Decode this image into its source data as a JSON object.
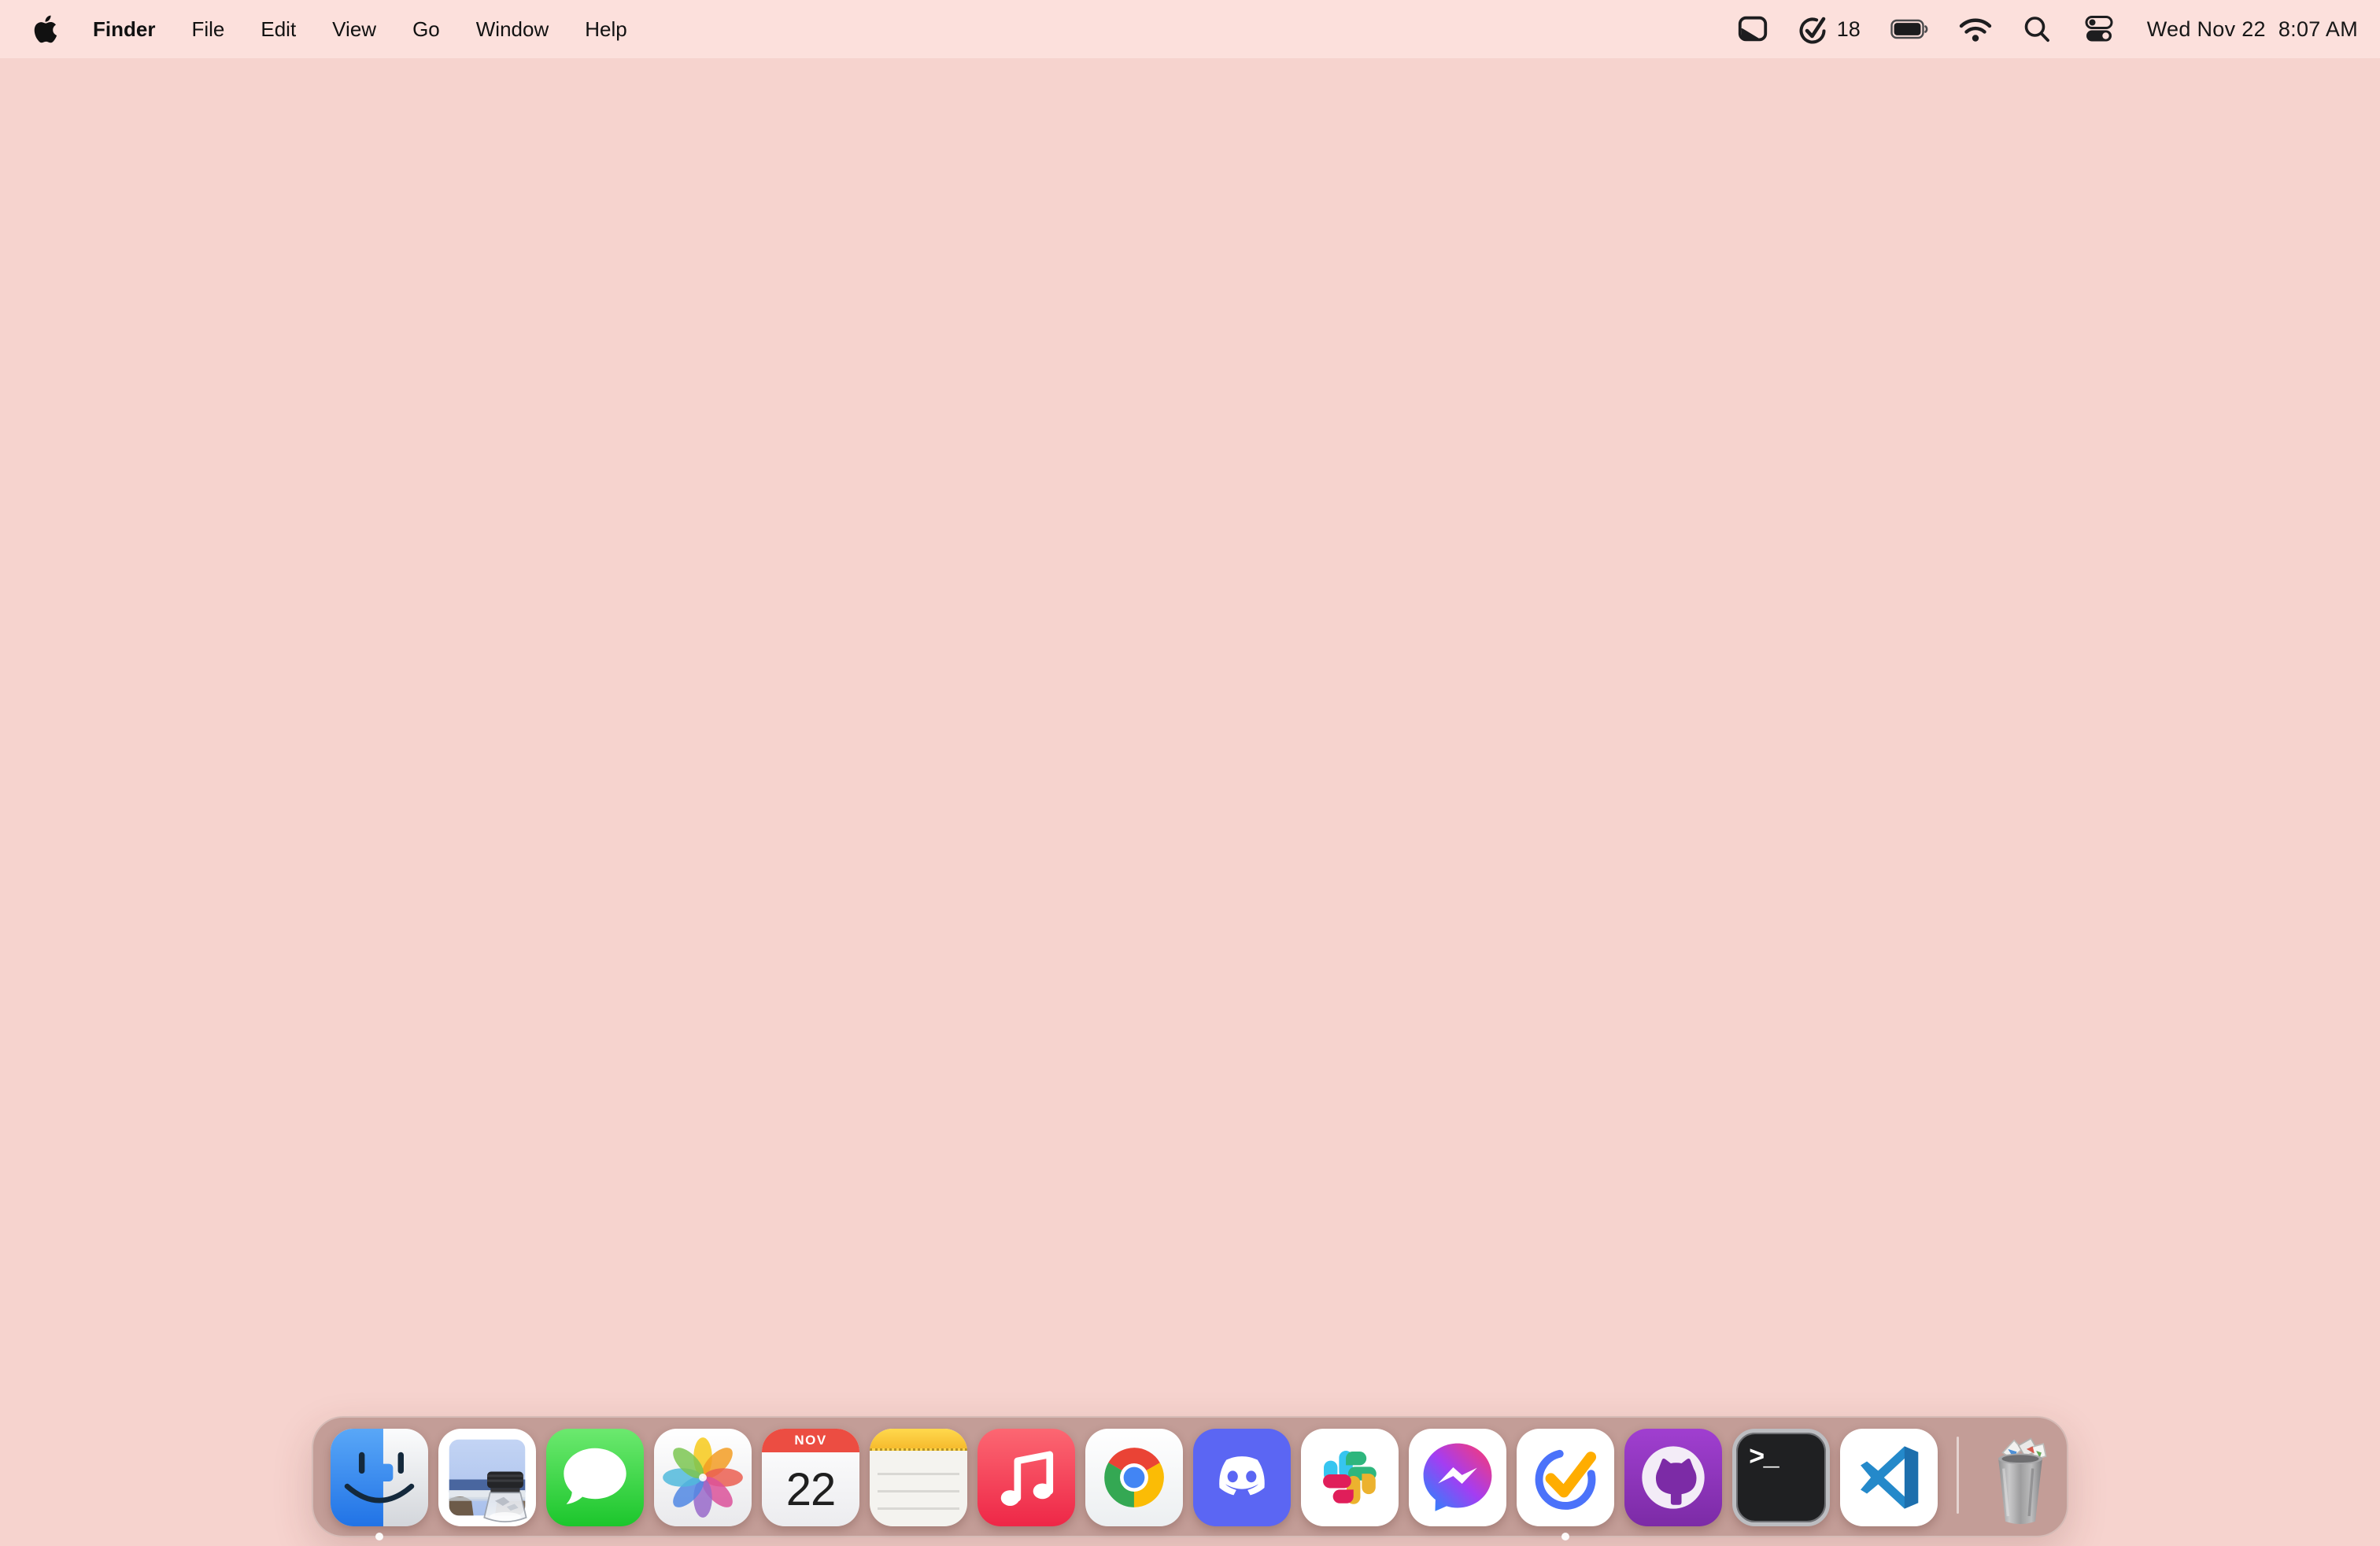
{
  "menu_bar": {
    "active_app_menus": [
      {
        "label": "Finder",
        "bold": true
      },
      {
        "label": "File"
      },
      {
        "label": "Edit"
      },
      {
        "label": "View"
      },
      {
        "label": "Go"
      },
      {
        "label": "Window"
      },
      {
        "label": "Help"
      }
    ],
    "status": {
      "screen_mirroring_icon": "screen-mirroring-icon",
      "task_badge": {
        "icon": "check-circle-icon",
        "count": "18"
      },
      "battery_icon": "battery-full-icon",
      "wifi_icon": "wifi-icon",
      "spotlight_icon": "search-icon",
      "control_center_icon": "control-center-icon",
      "date": "Wed Nov 22",
      "time": "8:07 AM"
    }
  },
  "desktop": {
    "wallpaper_color": "#f6d3ce",
    "menubar_color": "#fce0dc"
  },
  "dock": {
    "background_color": "rgba(143,103,96,0.50)",
    "apps": [
      {
        "name": "finder",
        "running": true
      },
      {
        "name": "preview",
        "running": false
      },
      {
        "name": "messages",
        "running": false
      },
      {
        "name": "photos",
        "running": false
      },
      {
        "name": "calendar",
        "running": false
      },
      {
        "name": "notes",
        "running": false
      },
      {
        "name": "music",
        "running": false
      },
      {
        "name": "chrome",
        "running": false
      },
      {
        "name": "discord",
        "running": false
      },
      {
        "name": "slack",
        "running": false
      },
      {
        "name": "messenger",
        "running": false
      },
      {
        "name": "ticktick",
        "running": true
      },
      {
        "name": "github",
        "running": false
      },
      {
        "name": "terminal",
        "running": false
      },
      {
        "name": "vscode",
        "running": false
      }
    ],
    "calendar": {
      "month": "NOV",
      "day": "22"
    },
    "terminal_prompt": ">_",
    "trash": "trash-full-icon"
  },
  "colors": {
    "discord": "#5865F2",
    "slack": [
      "#36C5F0",
      "#2EB67D",
      "#ECB22E",
      "#E01E5A"
    ],
    "chrome": [
      "#EA4335",
      "#34A853",
      "#FBBC05",
      "#4285F4"
    ],
    "ticktick_blue": "#4B72FA",
    "ticktick_check": "#FFAD00",
    "github_purple": "#8a35b4",
    "music_red": "#f43b55",
    "messages_green": "#31d23b",
    "messenger_gradient": [
      "#ff3a6b",
      "#a43df2",
      "#1d8cfd"
    ],
    "calendar_red": "#ec4d42",
    "notes_yellow": "#f6bb2e",
    "vscode_blue": "#2489ca",
    "finder_blue": "#3b8df0"
  }
}
